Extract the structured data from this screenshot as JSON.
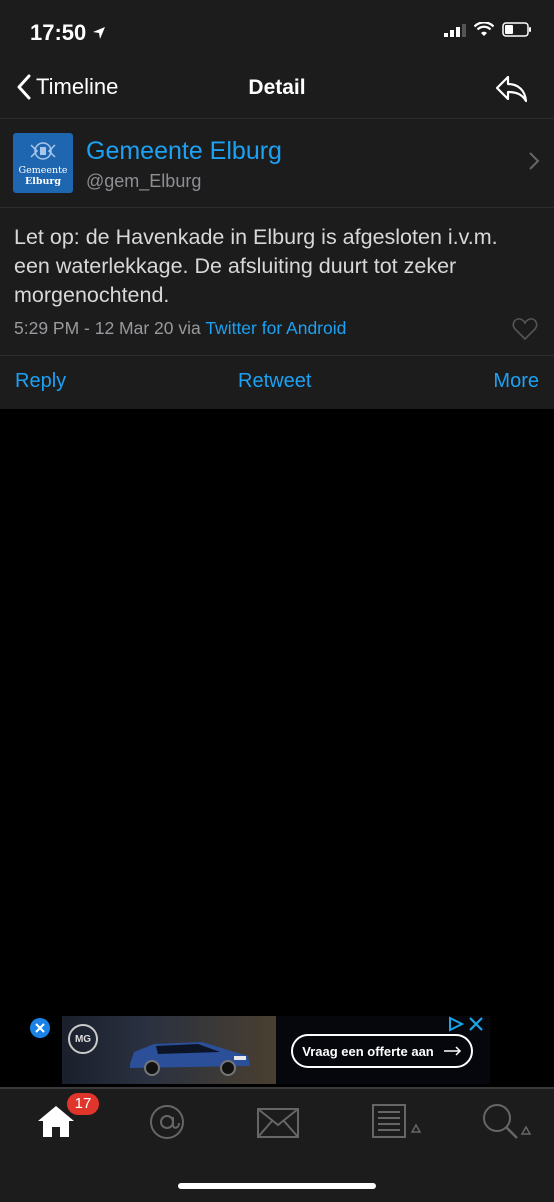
{
  "status": {
    "time": "17:50"
  },
  "nav": {
    "back_label": "Timeline",
    "title": "Detail"
  },
  "tweet": {
    "display_name": "Gemeente Elburg",
    "handle": "@gem_Elburg",
    "avatar_text_line1": "Gemeente",
    "avatar_text_line2": "Elburg",
    "text": "Let op: de Havenkade in Elburg is afgesloten i.v.m. een waterlekkage. De afsluiting duurt tot zeker morgenochtend.",
    "timestamp": "5:29 PM - 12 Mar 20",
    "via": "via",
    "source": "Twitter for Android"
  },
  "actions": {
    "reply": "Reply",
    "retweet": "Retweet",
    "more": "More"
  },
  "ad": {
    "brand": "MG",
    "cta": "Vraag een offerte aan"
  },
  "tabbar": {
    "badge_count": "17",
    "icons": [
      "home-icon",
      "mentions-icon",
      "messages-icon",
      "lists-icon",
      "search-icon"
    ]
  },
  "colors": {
    "accent": "#1da1f2",
    "background": "#000000",
    "panel": "#1c1c1d",
    "badge": "#e0352b",
    "avatar": "#1f66b1"
  }
}
